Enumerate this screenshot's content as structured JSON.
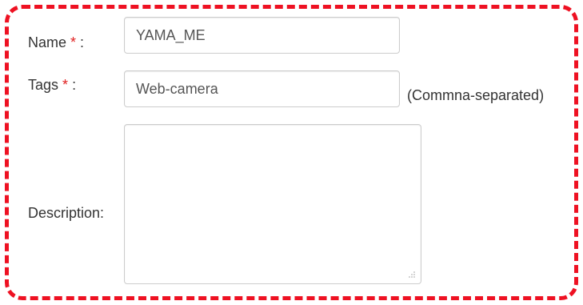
{
  "form": {
    "name": {
      "label": "Name",
      "required_mark": "*",
      "suffix": " :",
      "value": "YAMA_ME"
    },
    "tags": {
      "label": "Tags",
      "required_mark": "*",
      "suffix": " :",
      "value": "Web-camera",
      "hint": "(Commna-separated)"
    },
    "description": {
      "label": "Description:",
      "value": ""
    }
  },
  "colors": {
    "highlight_border": "#ee1122",
    "required_mark": "#e02020"
  }
}
